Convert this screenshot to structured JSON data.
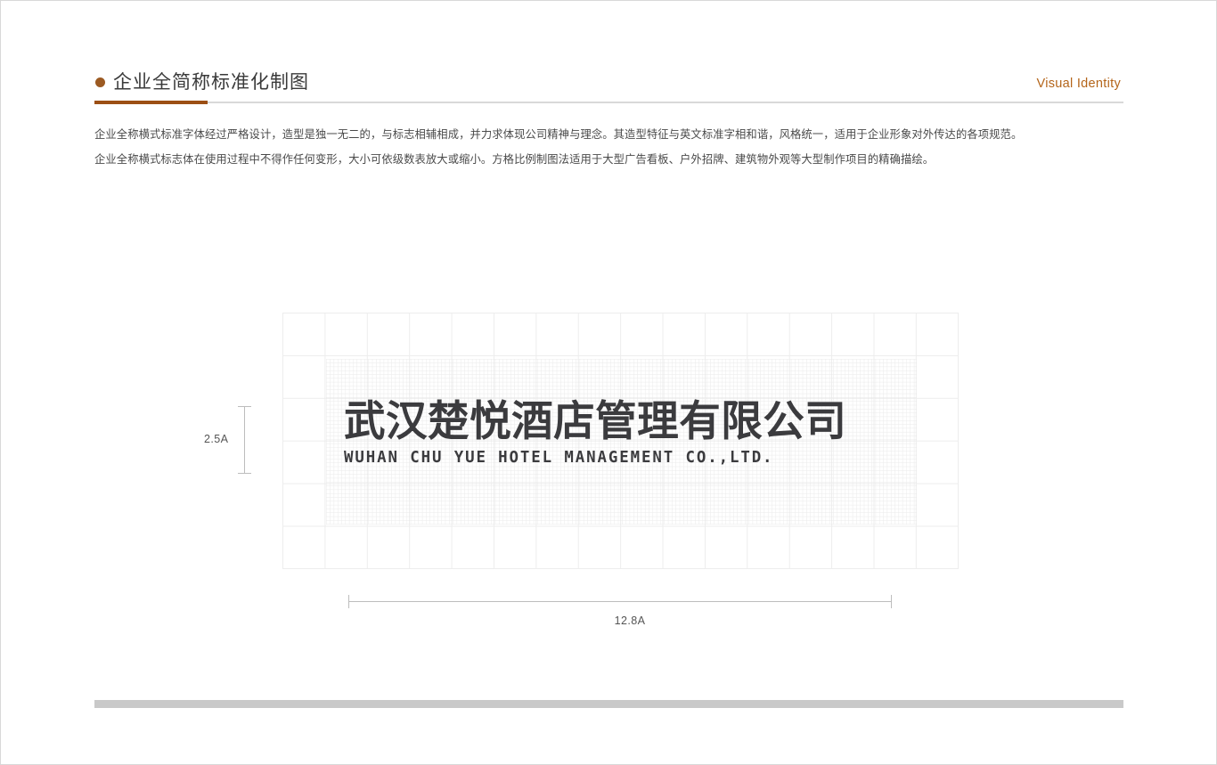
{
  "header": {
    "bullet_color": "#9c5a22",
    "title": "企业全简称标准化制图",
    "right_label": "Visual Identity",
    "accent_color": "#9c4f14"
  },
  "intro": {
    "line1": "企业全称横式标准字体经过严格设计，造型是独一无二的，与标志相辅相成，并力求体现公司精神与理念。其造型特征与英文标准字相和谐，风格统一，适用于企业形象对外传达的各项规范。",
    "line2": "企业全称横式标志体在使用过程中不得作任何变形，大小可依级数表放大或缩小。方格比例制图法适用于大型广告看板、户外招牌、建筑物外观等大型制作项目的精确描绘。"
  },
  "artwork": {
    "logo_cn": "武汉楚悦酒店管理有限公司",
    "logo_en": "WUHAN CHU YUE HOTEL MANAGEMENT CO.,LTD.",
    "logo_color": "#3b3b3e",
    "dimension_vertical": "2.5A",
    "dimension_horizontal": "12.8A",
    "grid_line_color": "#ededed",
    "dimension_line_color": "#bdbdbd"
  },
  "footer": {
    "bar_color": "#c9c9c9"
  }
}
